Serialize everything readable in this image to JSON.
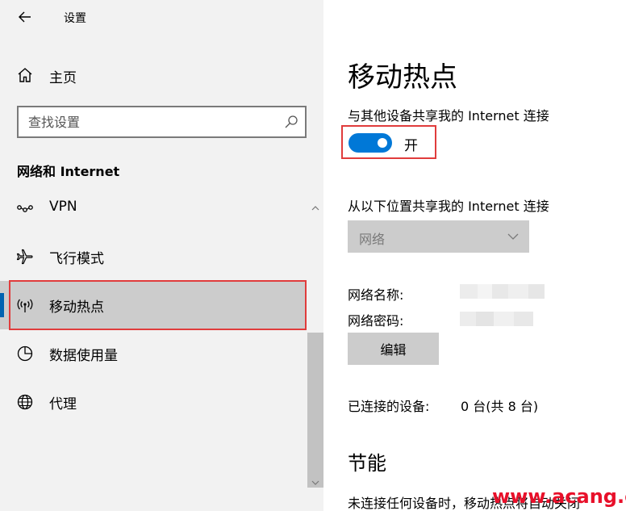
{
  "window": {
    "title": "设置"
  },
  "sidebar": {
    "home_label": "主页",
    "search_placeholder": "查找设置",
    "section_heading": "网络和 Internet",
    "items": [
      {
        "label": "VPN",
        "icon": "vpn-icon"
      },
      {
        "label": "飞行模式",
        "icon": "airplane-icon"
      },
      {
        "label": "移动热点",
        "icon": "hotspot-icon",
        "selected": true
      },
      {
        "label": "数据使用量",
        "icon": "data-usage-icon"
      },
      {
        "label": "代理",
        "icon": "globe-icon"
      }
    ]
  },
  "main": {
    "title": "移动热点",
    "share_label": "与其他设备共享我的 Internet 连接",
    "toggle": {
      "on": true,
      "state_label": "开"
    },
    "from_label": "从以下位置共享我的 Internet 连接",
    "network_select": {
      "value": "网络"
    },
    "network_name_label": "网络名称:",
    "network_password_label": "网络密码:",
    "edit_button_label": "编辑",
    "connected_devices_label": "已连接的设备:",
    "connected_devices_value": "0 台(共 8 台)",
    "power_saving_heading": "节能",
    "power_saving_text": "未连接任何设备时，移动热点将自动关闭"
  },
  "watermark": "www.acang.cn",
  "colors": {
    "accent": "#0078d7",
    "highlight_box": "#e03c3c",
    "sidebar_bg": "#f2f2f2",
    "selected_bg": "#cccccc",
    "watermark": "#e8102a"
  }
}
